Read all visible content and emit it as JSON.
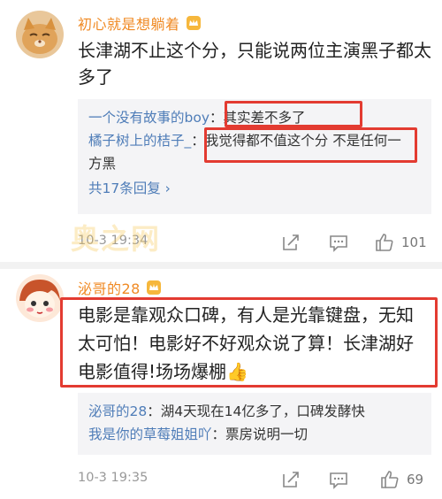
{
  "colors": {
    "username": "#f08a24",
    "link": "#4f7db8",
    "highlight": "#e33b31",
    "meta": "#999999"
  },
  "comments": [
    {
      "username": "初心就是想躺着",
      "badge_icon": "vip-crown-icon",
      "text": "长津湖不止这个分，只能说两位主演黑子都太多了",
      "replies": [
        {
          "user": "一个没有故事的boy",
          "sep": "：",
          "text": "其实差不多了"
        },
        {
          "user": "橘子树上的桔子_",
          "sep": "：",
          "text": "我觉得都不值这个分 不是任何一方黑"
        }
      ],
      "more_replies": "共17条回复 ›",
      "time": "10-3 19:34",
      "likes": "101"
    },
    {
      "username": "泌哥的28",
      "badge_icon": "vip-crown-icon",
      "text": "电影是靠观众口碑，有人是光靠键盘，无知太可怕！电影好不好观众说了算！长津湖好电影值得!场场爆棚👍",
      "replies": [
        {
          "user": "泌哥的28",
          "sep": "：",
          "text": "湖4天现在14亿多了，口碑发酵快"
        },
        {
          "user": "我是你的草莓姐姐吖",
          "sep": "：",
          "text": "票房说明一切"
        }
      ],
      "time": "10-3 19:35",
      "likes": "69"
    }
  ],
  "watermark": "奥之网"
}
